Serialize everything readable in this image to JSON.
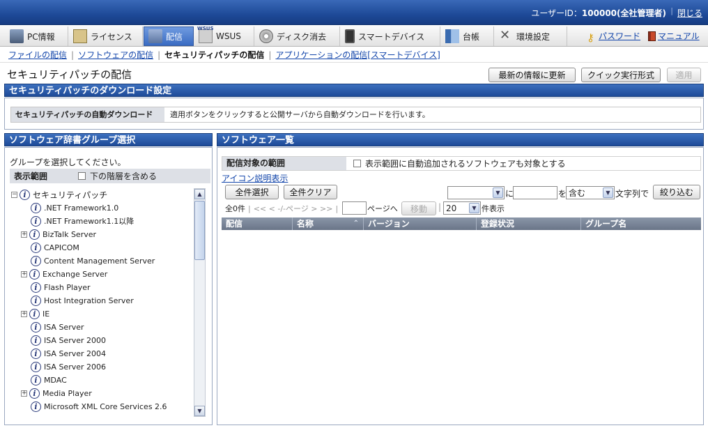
{
  "header": {
    "user_label": "ユーザーID：",
    "user_id": "100000(全社管理者)",
    "logout": "閉じる"
  },
  "menu": {
    "items": [
      {
        "label": "PC情報",
        "icon": "pc-icon"
      },
      {
        "label": "ライセンス",
        "icon": "license-icon"
      },
      {
        "label": "配信",
        "icon": "distribution-icon",
        "active": true
      },
      {
        "label": "WSUS",
        "icon": "wsus-icon"
      },
      {
        "label": "ディスク消去",
        "icon": "disk-erase-icon"
      },
      {
        "label": "スマートデバイス",
        "icon": "smartphone-icon"
      },
      {
        "label": "台帳",
        "icon": "ledger-icon"
      },
      {
        "label": "環境設定",
        "icon": "settings-tools-icon"
      }
    ],
    "password": "パスワード",
    "manual": "マニュアル"
  },
  "submenu": {
    "file": "ファイルの配信",
    "software": "ソフトウェアの配信",
    "patch": "セキュリティパッチの配信",
    "app": "アプリケーションの配信[スマートデバイス]"
  },
  "page": {
    "title": "セキュリティパッチの配信",
    "refresh_button": "最新の情報に更新",
    "quick_button": "クイック実行形式",
    "apply_button": "適用"
  },
  "download": {
    "section_title": "セキュリティパッチのダウンロード設定",
    "auto_label": "セキュリティパッチの自動ダウンロード",
    "auto_desc": "適用ボタンをクリックすると公開サーバから自動ダウンロードを行います。"
  },
  "group": {
    "section_title": "ソフトウェア辞書グループ選択",
    "prompt": "グループを選択してください。",
    "scope_label": "表示範囲",
    "include_sub": "下の階層を含める",
    "tree": {
      "root": "セキュリティパッチ",
      "nodes": [
        {
          "label": ".NET Framework1.0",
          "expand": false
        },
        {
          "label": ".NET Framework1.1以降",
          "expand": false
        },
        {
          "label": "BizTalk Server",
          "expand": true
        },
        {
          "label": "CAPICOM",
          "expand": false
        },
        {
          "label": "Content Management Server",
          "expand": false
        },
        {
          "label": "Exchange Server",
          "expand": true
        },
        {
          "label": "Flash Player",
          "expand": false
        },
        {
          "label": "Host Integration Server",
          "expand": false
        },
        {
          "label": "IE",
          "expand": true
        },
        {
          "label": "ISA Server",
          "expand": false
        },
        {
          "label": "ISA Server 2000",
          "expand": false
        },
        {
          "label": "ISA Server 2004",
          "expand": false
        },
        {
          "label": "ISA Server 2006",
          "expand": false
        },
        {
          "label": "MDAC",
          "expand": false
        },
        {
          "label": "Media Player",
          "expand": true
        },
        {
          "label": "Microsoft XML Core Services 2.6",
          "expand": false
        }
      ]
    }
  },
  "software": {
    "section_title": "ソフトウェア一覧",
    "target_label": "配信対象の範囲",
    "target_text": "表示範囲に自動追加されるソフトウェアも対象とする",
    "icon_link": "アイコン説明表示",
    "select_all": "全件選択",
    "clear_all": "全件クリア",
    "filter": {
      "field_value": "",
      "in_label": "に",
      "keyword_value": "",
      "wo_label": "を",
      "condition": "含む",
      "suffix": "文字列で",
      "button": "絞り込む"
    },
    "pager": {
      "count": "全0件",
      "nav": "<< < -/-ページ > >>",
      "page_value": "",
      "page_to": "ページへ",
      "move_button": "移動",
      "per_page": "20",
      "per_page_suffix": "件表示"
    },
    "columns": [
      "配信",
      "名称",
      "バージョン",
      "登録状況",
      "グループ名"
    ],
    "rows": []
  }
}
